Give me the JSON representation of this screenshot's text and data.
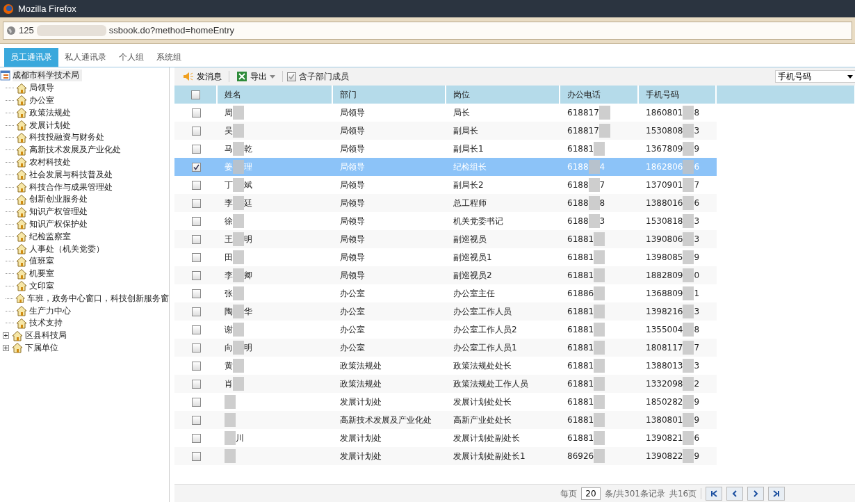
{
  "window": {
    "title": "Mozilla Firefox"
  },
  "address_bar": {
    "url_start": "125",
    "url_end": "ssbook.do?method=homeEntry"
  },
  "tabs": [
    {
      "label": "员工通讯录",
      "selected": true
    },
    {
      "label": "私人通讯录",
      "selected": false
    },
    {
      "label": "个人组",
      "selected": false
    },
    {
      "label": "系统组",
      "selected": false
    }
  ],
  "tree": {
    "label": "成都市科学技术局",
    "selected": true,
    "children": [
      {
        "label": "局领导",
        "expandable": false
      },
      {
        "label": "办公室",
        "expandable": false
      },
      {
        "label": "政策法规处",
        "expandable": false
      },
      {
        "label": "发展计划处",
        "expandable": false
      },
      {
        "label": "科技投融资与财务处",
        "expandable": false
      },
      {
        "label": "高新技术发展及产业化处",
        "expandable": false
      },
      {
        "label": "农村科技处",
        "expandable": false
      },
      {
        "label": "社会发展与科技普及处",
        "expandable": false
      },
      {
        "label": "科技合作与成果管理处",
        "expandable": false
      },
      {
        "label": "创新创业服务处",
        "expandable": false
      },
      {
        "label": "知识产权管理处",
        "expandable": false
      },
      {
        "label": "知识产权保护处",
        "expandable": false
      },
      {
        "label": "纪检监察室",
        "expandable": false
      },
      {
        "label": "人事处（机关党委）",
        "expandable": false
      },
      {
        "label": "值班室",
        "expandable": false
      },
      {
        "label": "机要室",
        "expandable": false
      },
      {
        "label": "文印室",
        "expandable": false
      },
      {
        "label": "车班，政务中心窗口，科技创新服务窗",
        "expandable": false
      },
      {
        "label": "生产力中心",
        "expandable": false
      },
      {
        "label": "技术支持",
        "expandable": false
      },
      {
        "label": "区县科技局",
        "expandable": true
      },
      {
        "label": "下属单位",
        "expandable": true
      }
    ]
  },
  "toolbar": {
    "send_message": "发消息",
    "export": "导出",
    "include_sub": {
      "label": "含子部门成员",
      "checked": true
    },
    "search_by": "手机号码"
  },
  "table": {
    "columns": [
      "姓名",
      "部门",
      "岗位",
      "办公电话",
      "手机号码"
    ],
    "header_checked": false,
    "rows": [
      {
        "name_start": "周",
        "name_end": "",
        "dept": "局领导",
        "post": "局长",
        "office_start": "618817",
        "office_end": "",
        "mobile_start": "1860801",
        "mobile_end": "8",
        "checked": false,
        "selected": false
      },
      {
        "name_start": "吴",
        "name_end": "",
        "dept": "局领导",
        "post": "副局长",
        "office_start": "618817",
        "office_end": "",
        "mobile_start": "1530808",
        "mobile_end": "3",
        "checked": false,
        "selected": false
      },
      {
        "name_start": "马",
        "name_end": "乾",
        "dept": "局领导",
        "post": "副局长1",
        "office_start": "61881",
        "office_end": "",
        "mobile_start": "1367809",
        "mobile_end": "9",
        "checked": false,
        "selected": false
      },
      {
        "name_start": "姜",
        "name_end": "理",
        "dept": "局领导",
        "post": "纪检组长",
        "office_start": "6188",
        "office_end": "4",
        "mobile_start": "1862806",
        "mobile_end": "6",
        "checked": true,
        "selected": true
      },
      {
        "name_start": "丁",
        "name_end": "斌",
        "dept": "局领导",
        "post": "副局长2",
        "office_start": "6188",
        "office_end": "7",
        "mobile_start": "1370901",
        "mobile_end": "7",
        "checked": false,
        "selected": false
      },
      {
        "name_start": "李",
        "name_end": "廷",
        "dept": "局领导",
        "post": "总工程师",
        "office_start": "6188",
        "office_end": "8",
        "mobile_start": "1388016",
        "mobile_end": "6",
        "checked": false,
        "selected": false
      },
      {
        "name_start": "徐",
        "name_end": "",
        "dept": "局领导",
        "post": "机关党委书记",
        "office_start": "6188",
        "office_end": "3",
        "mobile_start": "1530818",
        "mobile_end": "3",
        "checked": false,
        "selected": false
      },
      {
        "name_start": "王",
        "name_end": "明",
        "dept": "局领导",
        "post": "副巡视员",
        "office_start": "61881",
        "office_end": "",
        "mobile_start": "1390806",
        "mobile_end": "3",
        "checked": false,
        "selected": false
      },
      {
        "name_start": "田",
        "name_end": "",
        "dept": "局领导",
        "post": "副巡视员1",
        "office_start": "61881",
        "office_end": "",
        "mobile_start": "1398085",
        "mobile_end": "9",
        "checked": false,
        "selected": false
      },
      {
        "name_start": "李",
        "name_end": "卿",
        "dept": "局领导",
        "post": "副巡视员2",
        "office_start": "61881",
        "office_end": "",
        "mobile_start": "1882809",
        "mobile_end": "0",
        "checked": false,
        "selected": false
      },
      {
        "name_start": "张",
        "name_end": "",
        "dept": "办公室",
        "post": "办公室主任",
        "office_start": "61886",
        "office_end": "",
        "mobile_start": "1368809",
        "mobile_end": "1",
        "checked": false,
        "selected": false
      },
      {
        "name_start": "陶",
        "name_end": "华",
        "dept": "办公室",
        "post": "办公室工作人员",
        "office_start": "61881",
        "office_end": "",
        "mobile_start": "1398216",
        "mobile_end": "3",
        "checked": false,
        "selected": false
      },
      {
        "name_start": "谢",
        "name_end": "",
        "dept": "办公室",
        "post": "办公室工作人员2",
        "office_start": "61881",
        "office_end": "",
        "mobile_start": "1355004",
        "mobile_end": "8",
        "checked": false,
        "selected": false
      },
      {
        "name_start": "向",
        "name_end": "明",
        "dept": "办公室",
        "post": "办公室工作人员1",
        "office_start": "61881",
        "office_end": "",
        "mobile_start": "1808117",
        "mobile_end": "7",
        "checked": false,
        "selected": false
      },
      {
        "name_start": "黄",
        "name_end": "",
        "dept": "政策法规处",
        "post": "政策法规处处长",
        "office_start": "61881",
        "office_end": "",
        "mobile_start": "1388013",
        "mobile_end": "3",
        "checked": false,
        "selected": false
      },
      {
        "name_start": "肖",
        "name_end": "",
        "dept": "政策法规处",
        "post": "政策法规处工作人员",
        "office_start": "61881",
        "office_end": "",
        "mobile_start": "1332098",
        "mobile_end": "2",
        "checked": false,
        "selected": false
      },
      {
        "name_start": "",
        "name_end": "",
        "dept": "发展计划处",
        "post": "发展计划处处长",
        "office_start": "61881",
        "office_end": "",
        "mobile_start": "1850282",
        "mobile_end": "9",
        "checked": false,
        "selected": false
      },
      {
        "name_start": "",
        "name_end": "",
        "dept": "高新技术发展及产业化处",
        "post": "高新产业处处长",
        "office_start": "61881",
        "office_end": "",
        "mobile_start": "1380801",
        "mobile_end": "9",
        "checked": false,
        "selected": false
      },
      {
        "name_start": "",
        "name_end": "川",
        "dept": "发展计划处",
        "post": "发展计划处副处长",
        "office_start": "61881",
        "office_end": "",
        "mobile_start": "1390821",
        "mobile_end": "6",
        "checked": false,
        "selected": false
      },
      {
        "name_start": "",
        "name_end": "",
        "dept": "发展计划处",
        "post": "发展计划处副处长1",
        "office_start": "86926",
        "office_end": "",
        "mobile_start": "1390822",
        "mobile_end": "9",
        "checked": false,
        "selected": false
      }
    ]
  },
  "pager": {
    "per_page_label": "每页",
    "per_page": "20",
    "records": "条/共301条记录",
    "pages": "共16页"
  }
}
